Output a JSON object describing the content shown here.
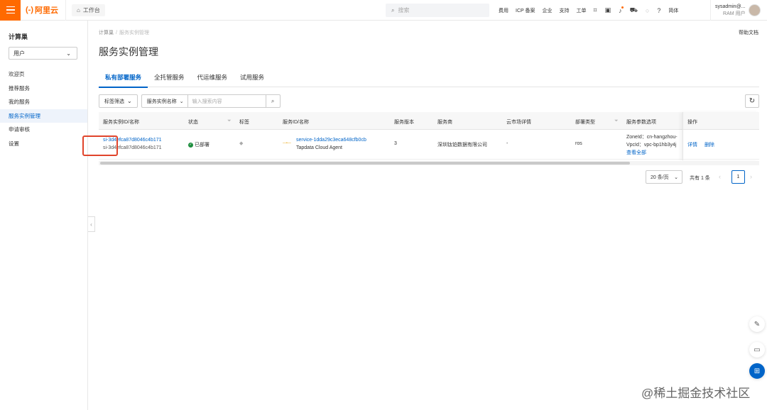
{
  "topbar": {
    "logo_mark": "(-)",
    "logo_text": "阿里云",
    "workbench": "工作台",
    "search_placeholder": "搜索",
    "nav": [
      "费用",
      "ICP 备案",
      "企业",
      "支持",
      "工单"
    ],
    "lang": "简体",
    "user_name": "sysadmin@...",
    "user_role": "RAM 用户"
  },
  "sidebar": {
    "title": "计算巢",
    "select_value": "用户",
    "items": [
      "欢迎页",
      "推荐服务",
      "我的服务",
      "服务实例管理",
      "申请审核",
      "设置"
    ]
  },
  "breadcrumb": [
    "计算巢",
    "服务实例管理"
  ],
  "help": "帮助文档",
  "page_title": "服务实例管理",
  "tabs": [
    "私有部署服务",
    "全托管服务",
    "代运维服务",
    "试用服务"
  ],
  "toolbar": {
    "tag_filter": "标签筛选",
    "search_field": "服务实例名称",
    "search_placeholder": "输入搜索内容"
  },
  "table": {
    "headers": [
      "服务实例ID/名称",
      "状态",
      "标签",
      "服务ID/名称",
      "服务版本",
      "服务商",
      "云市场详情",
      "部署类型",
      "服务参数选项",
      "操作"
    ],
    "row": {
      "instance_id": "si-3d4efca87d8046c4b171",
      "instance_name": "si-3d4efca87d8046c4b171",
      "status": "已部署",
      "service_id": "service-1dda29c3eca648cfb0cb",
      "service_name": "Tapdata Cloud Agent",
      "version": "3",
      "provider": "深圳钛铂数据有限公司",
      "market": "-",
      "deploy_type": "ros",
      "param1": "ZoneId：cn-hangzhou-",
      "param2": "VpcId：vpc-bp1hb3y4j",
      "param_more": "查看全部",
      "op_detail": "详情",
      "op_delete": "删除"
    }
  },
  "pagination": {
    "page_size": "20 条/页",
    "total": "共有 1 条",
    "current": "1"
  },
  "watermark": "@稀土掘金技术社区"
}
